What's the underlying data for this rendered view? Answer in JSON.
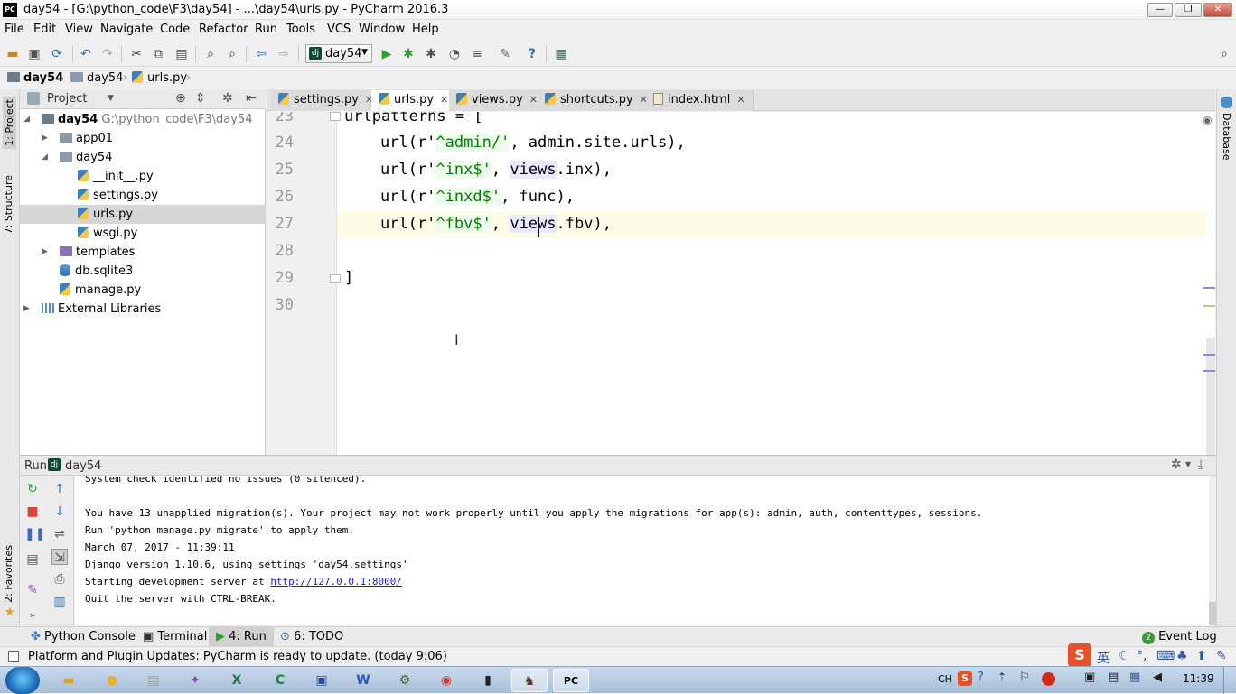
{
  "window": {
    "title": "day54 - [G:\\python_code\\F3\\day54] - ...\\day54\\urls.py - PyCharm 2016.3",
    "app_icon": "PC"
  },
  "menu": [
    "File",
    "Edit",
    "View",
    "Navigate",
    "Code",
    "Refactor",
    "Run",
    "Tools",
    "VCS",
    "Window",
    "Help"
  ],
  "toolbar": {
    "run_config": "day54"
  },
  "breadcrumb": [
    "day54",
    "day54",
    "urls.py"
  ],
  "project": {
    "header": "Project",
    "items": [
      {
        "label": "day54",
        "path": "G:\\python_code\\F3\\day54"
      },
      {
        "label": "app01"
      },
      {
        "label": "day54"
      },
      {
        "label": "__init__.py"
      },
      {
        "label": "settings.py"
      },
      {
        "label": "urls.py"
      },
      {
        "label": "wsgi.py"
      },
      {
        "label": "templates"
      },
      {
        "label": "db.sqlite3"
      },
      {
        "label": "manage.py"
      },
      {
        "label": "External Libraries"
      }
    ]
  },
  "side_tabs": {
    "project": "1: Project",
    "structure": "7: Structure",
    "favorites": "2: Favorites",
    "database": "Database"
  },
  "tabs": [
    "settings.py",
    "urls.py",
    "views.py",
    "shortcuts.py",
    "index.html"
  ],
  "editor": {
    "line_numbers": [
      "23",
      "24",
      "25",
      "26",
      "27",
      "28",
      "29",
      "30"
    ],
    "line23": "urlpatterns = [",
    "l24a": "url(r'",
    "l24s": "^admin/'",
    "l24b": ", admin.site.urls),",
    "l25a": "url(r'",
    "l25s": "^inx$'",
    "l25c": ", ",
    "l25h": "views",
    "l25b": ".inx),",
    "l26a": "url(r'",
    "l26s": "^inxd$'",
    "l26b": ", func),",
    "l27a": "url(r'",
    "l27s": "^fbv$'",
    "l27c": ", ",
    "l27h": "views",
    "l27b": ".fbv),",
    "line29": "]"
  },
  "run_panel": {
    "label": "Run",
    "config": "day54",
    "lines": [
      "System check identified no issues (0 silenced).",
      "",
      "You have 13 unapplied migration(s). Your project may not work properly until you apply the migrations for app(s): admin, auth, contenttypes, sessions.",
      "Run 'python manage.py migrate' to apply them.",
      "March 07, 2017 - 11:39:11",
      "Django version 1.10.6, using settings 'day54.settings'"
    ],
    "server_prefix": "Starting development server at ",
    "server_url": "http://127.0.0.1:8000/",
    "quit_line": "Quit the server with CTRL-BREAK."
  },
  "bottom_tabs": {
    "python_console": "Python Console",
    "terminal": "Terminal",
    "run": "4: Run",
    "todo": "6: TODO",
    "event_log": "Event Log",
    "event_count": "2"
  },
  "status": {
    "message": "Platform and Plugin Updates: PyCharm is ready to update. (today 9:06)"
  },
  "taskbar": {
    "lang": "CH",
    "ime": "英",
    "clock": "11:39"
  },
  "colors": {
    "string": "#008000",
    "highlight": "#e8e8ff",
    "caret_line": "#fefbe7",
    "link": "#1b1bd0"
  }
}
